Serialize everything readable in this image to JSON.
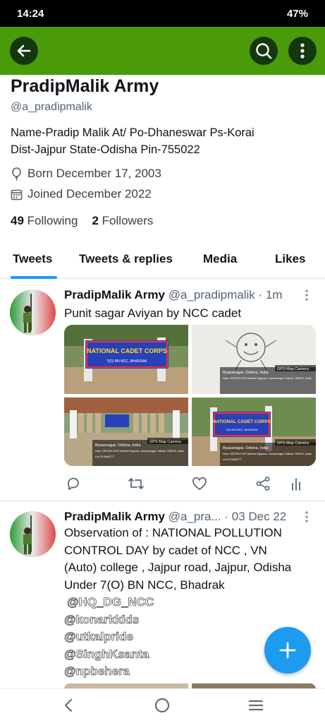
{
  "status_bar": {
    "time": "14:24",
    "battery": "47%"
  },
  "app_bar": {
    "back_icon": "arrow-left-icon",
    "search_icon": "search-icon",
    "more_icon": "more-vertical-icon",
    "color": "#4a9a0a"
  },
  "profile": {
    "name": "PradipMalik Army",
    "handle": "@a_pradipmalik",
    "bio_line1": "Name-Pradip Malik At/ Po-Dhaneswar Ps-Korai",
    "bio_line2": "Dist-Jajpur State-Odisha Pin-755022",
    "born": "Born December 17, 2003",
    "joined": "Joined December 2022",
    "following_count": "49",
    "following_label": "Following",
    "followers_count": "2",
    "followers_label": "Followers"
  },
  "tabs": [
    {
      "label": "Tweets",
      "active": true
    },
    {
      "label": "Tweets & replies"
    },
    {
      "label": "Media"
    },
    {
      "label": "Likes"
    }
  ],
  "tweets": [
    {
      "name": "PradipMalik Army",
      "handle": "@a_pradipmalik",
      "time": "· 1m",
      "text": "Punit sagar Aviyan by NCC cadet",
      "media": [
        {
          "banner": "NATIONAL CADET CORPS",
          "sub": "7(O) BN NCC, BHADRAK"
        },
        {
          "overlay_title": "Byasanagar, Odisha, India",
          "overlay_line": "Near HESON DVE Naheko Bypass, Dwarenagar Odisha 755019, India",
          "badge": "GPS Map Camera"
        },
        {
          "overlay_title": "Byasanagar, Odisha, India",
          "overlay_line": "Near HESON DVE Naheko Bypass, Dwarenagar Odisha 755019, India",
          "overlay_lat": "Lat 20.846077°",
          "badge": "GPS Map Camera"
        },
        {
          "banner": "NATIONAL CADET CORPS",
          "sub": "7(O) BN NCC, BHADRAK",
          "overlay_title": "Byasanagar, Odisha, India",
          "overlay_line": "Near HESON DVE Naheko Bypass, Dwarenagar Odisha 755019, India",
          "overlay_lat": "Lat 20.846077°",
          "badge": "GPS Map Camera"
        }
      ]
    },
    {
      "name": "PradipMalik Army",
      "handle": "@a_pra...",
      "time": "· 03 Dec 22",
      "lines": [
        "Observation of : NATIONAL POLLUTION",
        "CONTROL DAY by  cadet of NCC , VN",
        "(Auto) college , Jajpur road, Jajpur, Odisha",
        "Under 7(O) BN NCC, Bhadrak"
      ],
      "mentions": [
        "@HQ_DG_NCC",
        "@konarkkids",
        "@utkalpride",
        "@SinghKsanta",
        "@npbehera"
      ]
    }
  ],
  "action_icons": [
    "reply-icon",
    "retweet-icon",
    "like-icon",
    "share-icon",
    "analytics-icon"
  ],
  "fab_icon": "plus-icon",
  "nav_icons": [
    "back-icon",
    "home-icon",
    "recents-icon"
  ],
  "colors": {
    "accent": "#1d9bf0",
    "app_bar": "#4a9a0a",
    "text": "#0f1419",
    "muted": "#536471"
  }
}
